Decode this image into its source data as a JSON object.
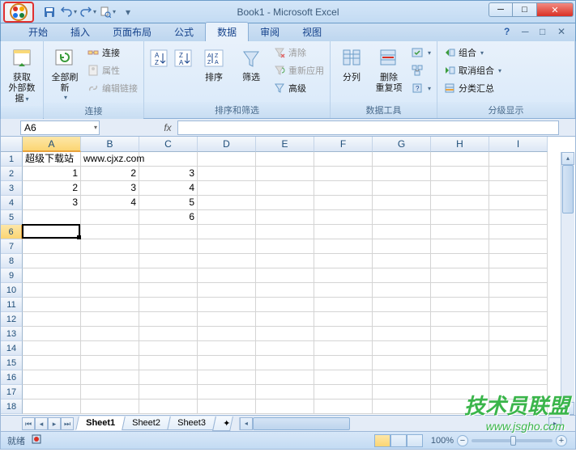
{
  "title": "Book1 - Microsoft Excel",
  "tabs": {
    "items": [
      "开始",
      "插入",
      "页面布局",
      "公式",
      "数据",
      "审阅",
      "视图"
    ],
    "active": "数据"
  },
  "ribbon": {
    "group1": {
      "label": "获取\n外部数据",
      "group_name": ""
    },
    "group2": {
      "refresh": "全部刷新",
      "conn": "连接",
      "prop": "属性",
      "links": "编辑链接",
      "group_name": "连接"
    },
    "group3": {
      "sort": "排序",
      "filter": "筛选",
      "clear": "清除",
      "reapply": "重新应用",
      "advanced": "高级",
      "group_name": "排序和筛选"
    },
    "group4": {
      "split": "分列",
      "dedup": "删除\n重复项",
      "group_name": "数据工具"
    },
    "group5": {
      "group": "组合",
      "ungroup": "取消组合",
      "subtotal": "分类汇总",
      "group_name": "分级显示"
    }
  },
  "name_box": "A6",
  "columns": [
    "A",
    "B",
    "C",
    "D",
    "E",
    "F",
    "G",
    "H",
    "I"
  ],
  "rows": [
    1,
    2,
    3,
    4,
    5,
    6,
    7,
    8,
    9,
    10,
    11,
    12,
    13,
    14,
    15,
    16,
    17,
    18
  ],
  "cells": {
    "A1": "超级下载站",
    "B1": "www.cjxz.com",
    "A2": "1",
    "B2": "2",
    "C2": "3",
    "A3": "2",
    "B3": "3",
    "C3": "4",
    "A4": "3",
    "B4": "4",
    "C4": "5",
    "C5": "6"
  },
  "active_cell": {
    "row": 6,
    "col": "A"
  },
  "sheets": {
    "items": [
      "Sheet1",
      "Sheet2",
      "Sheet3"
    ],
    "active": "Sheet1"
  },
  "status": {
    "ready": "就绪",
    "zoom": "100%"
  },
  "watermark": {
    "main": "技术员联盟",
    "sub": "www.jsgho.com"
  }
}
